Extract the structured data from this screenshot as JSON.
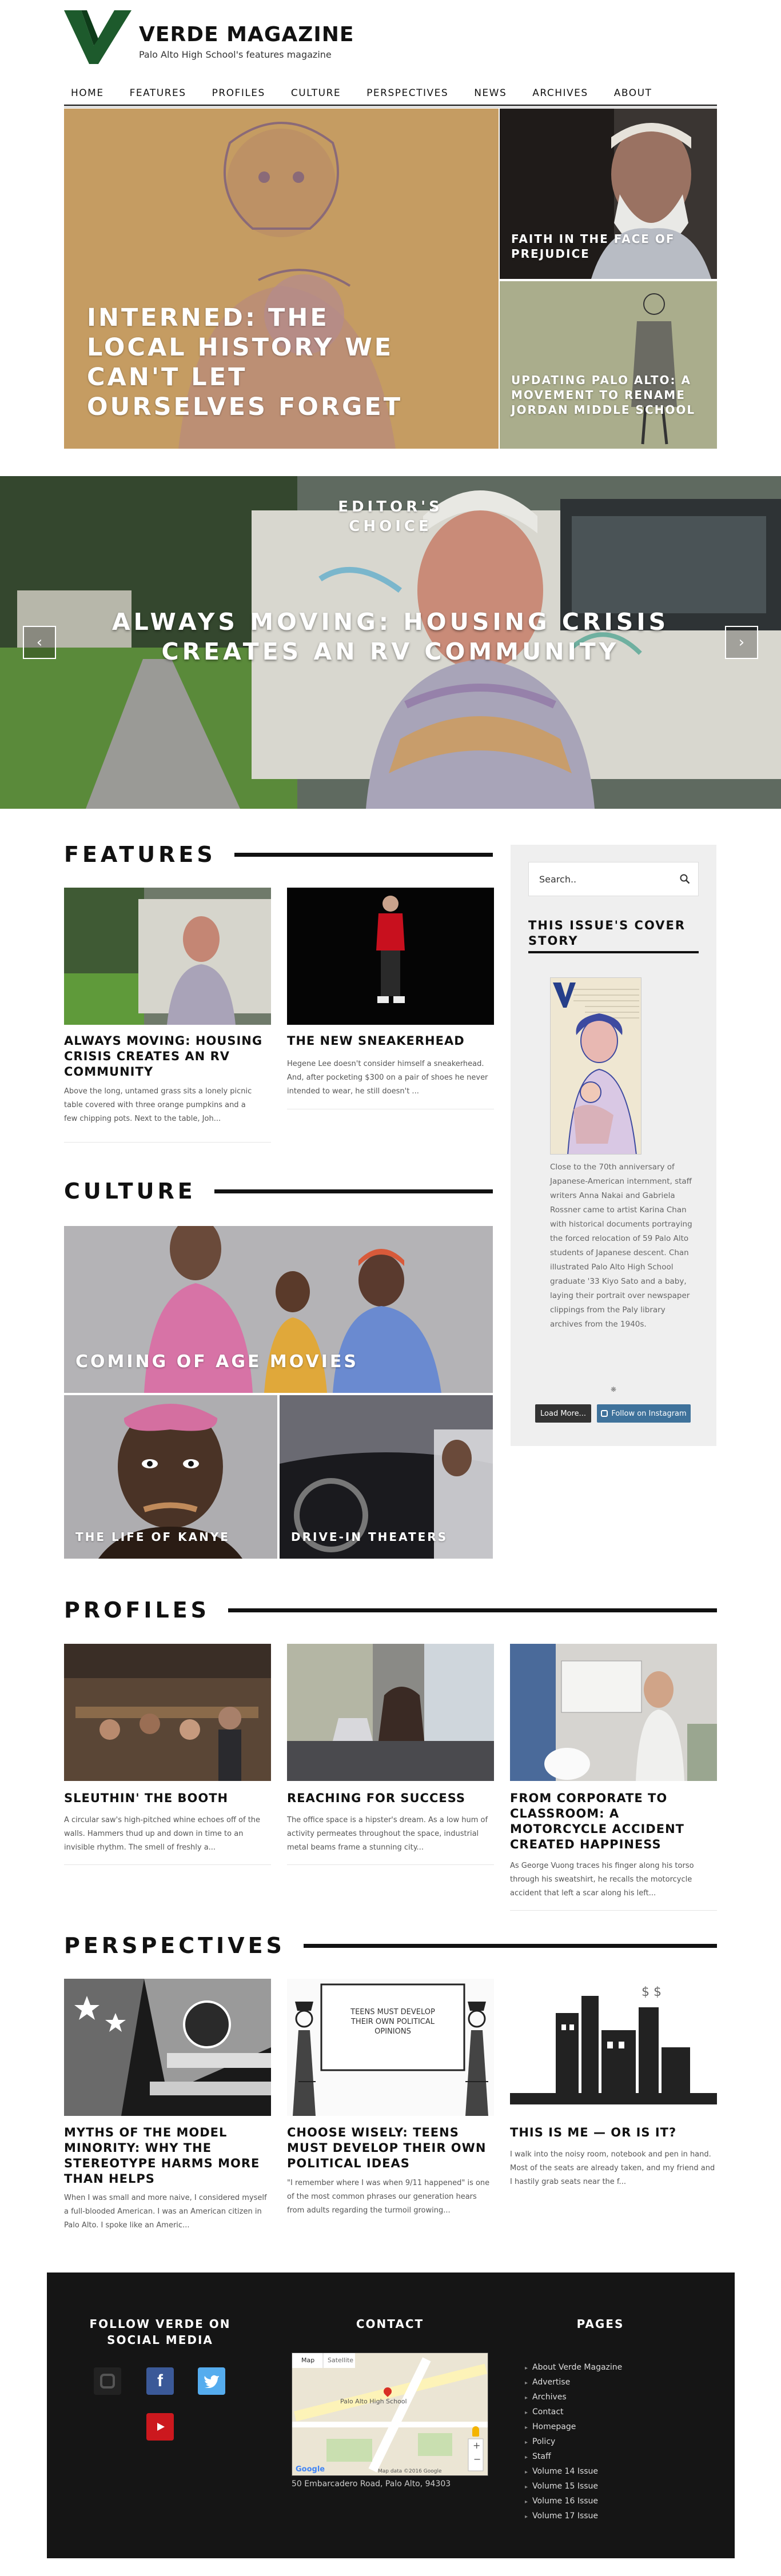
{
  "site": {
    "title": "VERDE MAGAZINE",
    "tagline": "Palo Alto High School's features magazine"
  },
  "nav": [
    "HOME",
    "FEATURES",
    "PROFILES",
    "CULTURE",
    "PERSPECTIVES",
    "NEWS",
    "ARCHIVES",
    "ABOUT"
  ],
  "hero": {
    "main_title": "INTERNED: THE LOCAL HISTORY WE CAN'T LET OURSELVES FORGET",
    "top_right_title": "FAITH IN THE FACE OF PREJUDICE",
    "bottom_right_title": "UPDATING PALO ALTO: A MOVEMENT TO RENAME JORDAN MIDDLE SCHOOL"
  },
  "slider": {
    "label": "EDITOR'S CHOICE",
    "title": "ALWAYS MOVING: HOUSING CRISIS CREATES AN RV COMMUNITY",
    "prev_icon": "chevron-left-icon",
    "next_icon": "chevron-right-icon"
  },
  "features": {
    "heading": "FEATURES",
    "cards": [
      {
        "title": "ALWAYS MOVING: HOUSING CRISIS CREATES AN RV COMMUNITY",
        "excerpt": "Above the long, untamed grass sits a lonely picnic table covered with three orange pumpkins and a few chipping pots. Next to the table, Joh..."
      },
      {
        "title": "THE NEW SNEAKERHEAD",
        "excerpt": "Hegene Lee doesn't consider himself a sneakerhead. And, after pocketing $300 on a pair of shoes he never intended to wear, he still doesn't ..."
      }
    ]
  },
  "culture": {
    "heading": "CULTURE",
    "tiles": [
      "COMING OF AGE MOVIES",
      "THE LIFE OF KANYE",
      "DRIVE-IN THEATERS"
    ]
  },
  "sidebar": {
    "search_placeholder": "Search..",
    "cover_heading": "THIS ISSUE'S COVER STORY",
    "cover_caption": "Close to the 70th anniversary of Japanese-American internment, staff writers Anna Nakai and Gabriela Rossner came to artist Karina Chan with historical documents portraying the forced relocation of 59 Palo Alto students of Japanese descent. Chan illustrated Palo Alto High School graduate '33 Kiyo Sato and a baby, laying their portrait over newspaper clippings from the Paly library archives from the 1940s.",
    "load_more": "Load More...",
    "follow_instagram": "Follow on Instagram"
  },
  "profiles": {
    "heading": "PROFILES",
    "cards": [
      {
        "title": "SLEUTHIN' THE BOOTH",
        "excerpt": "A circular saw's high-pitched whine echoes off of the walls. Hammers thud up and down in time to an invisible rhythm. The smell of freshly a..."
      },
      {
        "title": "REACHING FOR SUCCESS",
        "excerpt": "The office space is a hipster's dream. As a low hum of activity permeates throughout the space, industrial metal beams frame a stunning city..."
      },
      {
        "title": "FROM CORPORATE TO CLASSROOM: A MOTORCYCLE ACCIDENT CREATED HAPPINESS",
        "excerpt": "As George Vuong traces his finger along his torso through his sweatshirt, he recalls the motorcycle accident that left a scar along his left..."
      }
    ]
  },
  "perspectives": {
    "heading": "PERSPECTIVES",
    "cards": [
      {
        "title": "MYTHS OF THE MODEL MINORITY: WHY THE STEREOTYPE HARMS MORE THAN HELPS",
        "excerpt": "When I was small and more naive, I considered myself a full-blooded American. I was an American citizen in Palo Alto. I spoke like an Americ..."
      },
      {
        "title": "CHOOSE WISELY: TEENS MUST DEVELOP THEIR OWN POLITICAL IDEAS",
        "excerpt": "\"I remember where I was when 9/11 happened\" is one of the most common phrases our generation hears from adults regarding the turmoil growing...",
        "sign_text": "TEENS MUST DEVELOP THEIR OWN POLITICAL OPINIONS"
      },
      {
        "title": "THIS IS ME — OR IS IT?",
        "excerpt": "I walk into the noisy room, notebook and pen in hand. Most of the seats are already taken, and my friend and I hastily grab seats near the f..."
      }
    ]
  },
  "footer": {
    "social_heading": "FOLLOW VERDE ON SOCIAL MEDIA",
    "contact_heading": "CONTACT",
    "pages_heading": "PAGES",
    "address": "50 Embarcadero Road, Palo Alto, 94303",
    "map": {
      "tab_map": "Map",
      "tab_satellite": "Satellite",
      "place": "Palo Alto High School",
      "attribution": "Google",
      "map_data": "Map data ©2016 Google"
    },
    "pages": [
      "About Verde Magazine",
      "Advertise",
      "Archives",
      "Contact",
      "Homepage",
      "Policy",
      "Staff",
      "Volume 14 Issue",
      "Volume 15 Issue",
      "Volume 16 Issue",
      "Volume 17 Issue"
    ]
  },
  "colors": {
    "brand_green": "#1d5a2c",
    "dark": "#151515",
    "instagram_blue": "#3f729b",
    "facebook_blue": "#3b5998",
    "twitter_blue": "#55acee",
    "youtube_red": "#cc181e"
  }
}
